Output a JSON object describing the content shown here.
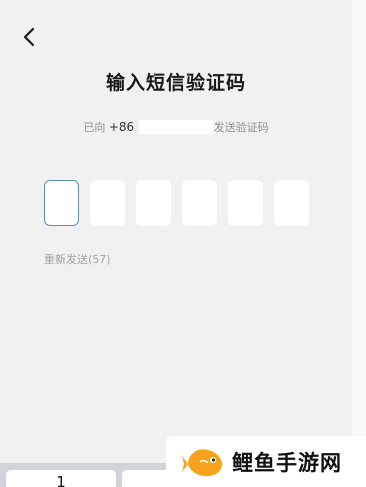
{
  "header": {
    "back_icon": "chevron-left-icon",
    "title": "输入短信验证码"
  },
  "sms_notice": {
    "prefix": "已向",
    "country_code": "+86",
    "suffix": "发送验证码"
  },
  "code_input": {
    "digits": [
      "",
      "",
      "",
      "",
      "",
      ""
    ],
    "active_index": 0
  },
  "resend": {
    "label": "重新发送(57)"
  },
  "keyboard": {
    "keys": [
      "1",
      ""
    ]
  },
  "watermark": {
    "icon": "fish-logo-icon",
    "text": "鲤鱼手游网"
  },
  "colors": {
    "background": "#f1f1f1",
    "active_border": "#5f8fb0",
    "logo_orange": "#f7a21b"
  }
}
